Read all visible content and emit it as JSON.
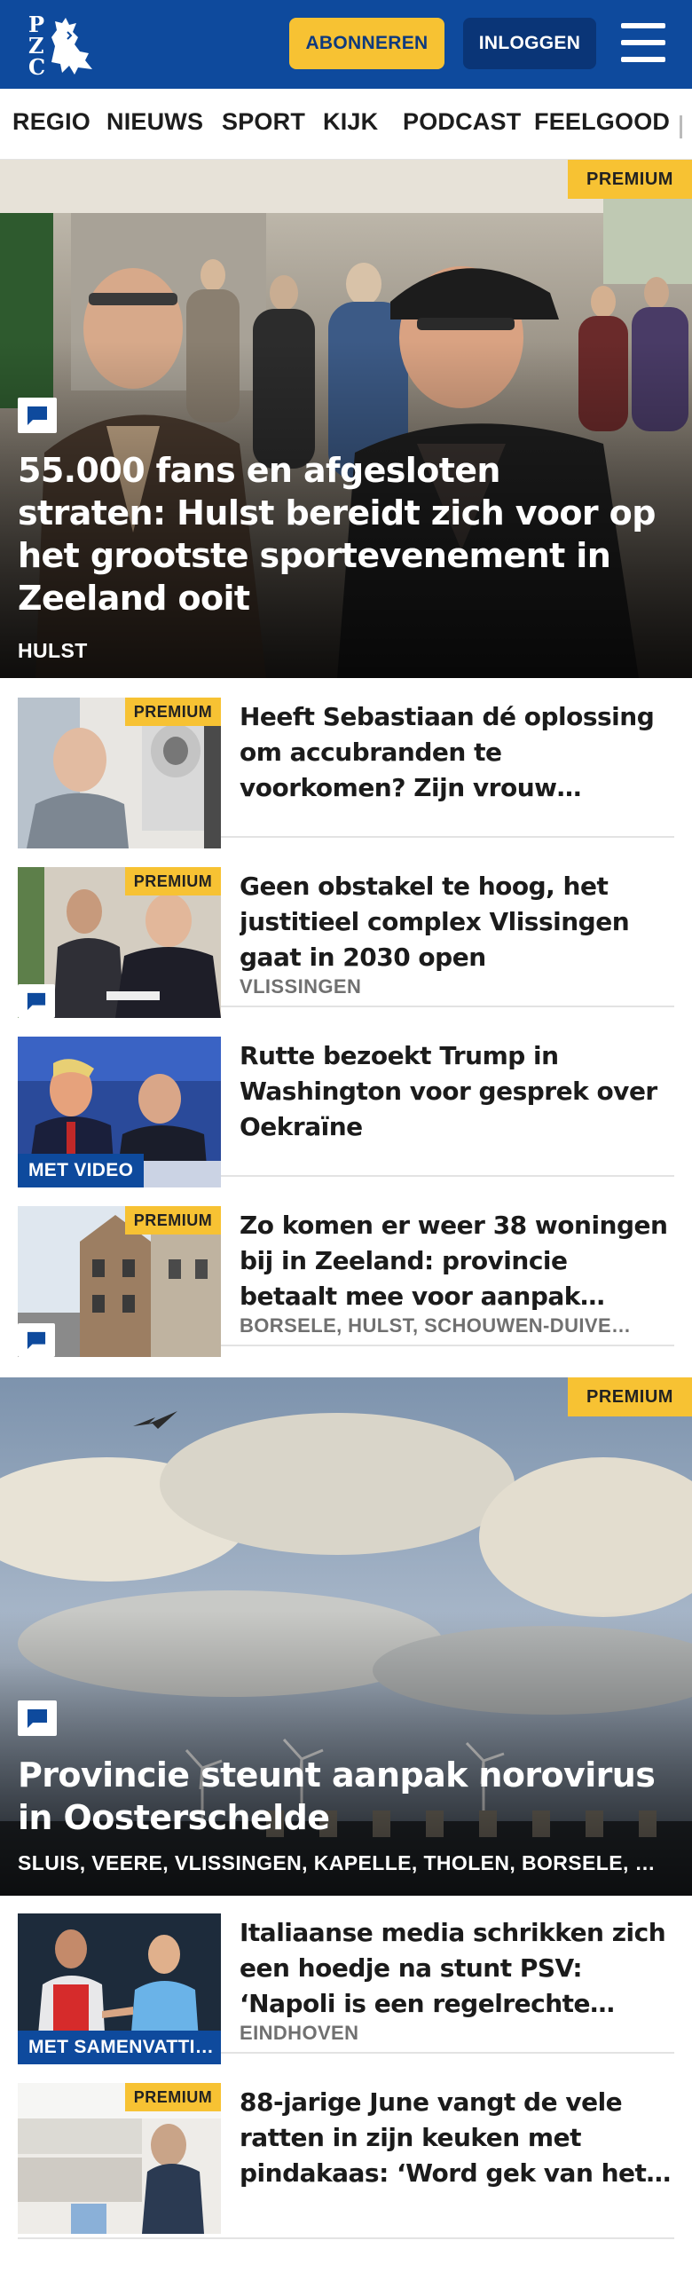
{
  "header": {
    "logo_letters": [
      "P",
      "Z",
      "C"
    ],
    "subscribe_label": "ABONNEREN",
    "login_label": "INLOGGEN",
    "colors": {
      "brand": "#0e4a9d",
      "accent": "#f7c233"
    }
  },
  "nav": {
    "items": [
      "REGIO",
      "NIEUWS",
      "SPORT",
      "KIJK",
      "PODCAST",
      "FEELGOOD"
    ]
  },
  "hero1": {
    "premium_label": "PREMIUM",
    "title": "55.000 fans en afgesloten straten: Hulst bereidt zich voor op het grootste sportevenement in Zeeland ooit",
    "location": "HULST",
    "icon": "comment-icon"
  },
  "articles": [
    {
      "premium_label": "PREMIUM",
      "title": "Heeft Sebastiaan dé oplossing om accubranden te voorkomen? Zijn vrouw gebruikt het al jaren",
      "location": ""
    },
    {
      "premium_label": "PREMIUM",
      "title": "Geen obstakel te hoog, het justitieel complex Vlissingen gaat in 2030 open",
      "location": "VLISSINGEN"
    },
    {
      "video_label": "MET VIDEO",
      "title": "Rutte bezoekt Trump in Washington voor gesprek over Oekraïne",
      "location": ""
    },
    {
      "premium_label": "PREMIUM",
      "title": "Zo komen er weer 38 woningen bij in Zeeland: provincie betaalt mee voor aanpak leegstaande…",
      "location": "BORSELE, HULST, SCHOUWEN-DUIVE…"
    }
  ],
  "hero2": {
    "premium_label": "PREMIUM",
    "title": "Provincie steunt aanpak norovirus in Oosterschelde",
    "location": "SLUIS, VEERE, VLISSINGEN, KAPELLE, THOLEN, BORSELE, …",
    "icon": "comment-icon"
  },
  "articles2": [
    {
      "video_label": "MET SAMENVATTI…",
      "title": "Italiaanse media schrikken zich een hoedje na stunt PSV: ‘Napoli is een regelrechte ramp’",
      "location": "EINDHOVEN"
    },
    {
      "premium_label": "PREMIUM",
      "title": "88-jarige June vangt de vele ratten in zijn keuken met pindakaas: ‘Word gek van het…",
      "location": ""
    }
  ]
}
